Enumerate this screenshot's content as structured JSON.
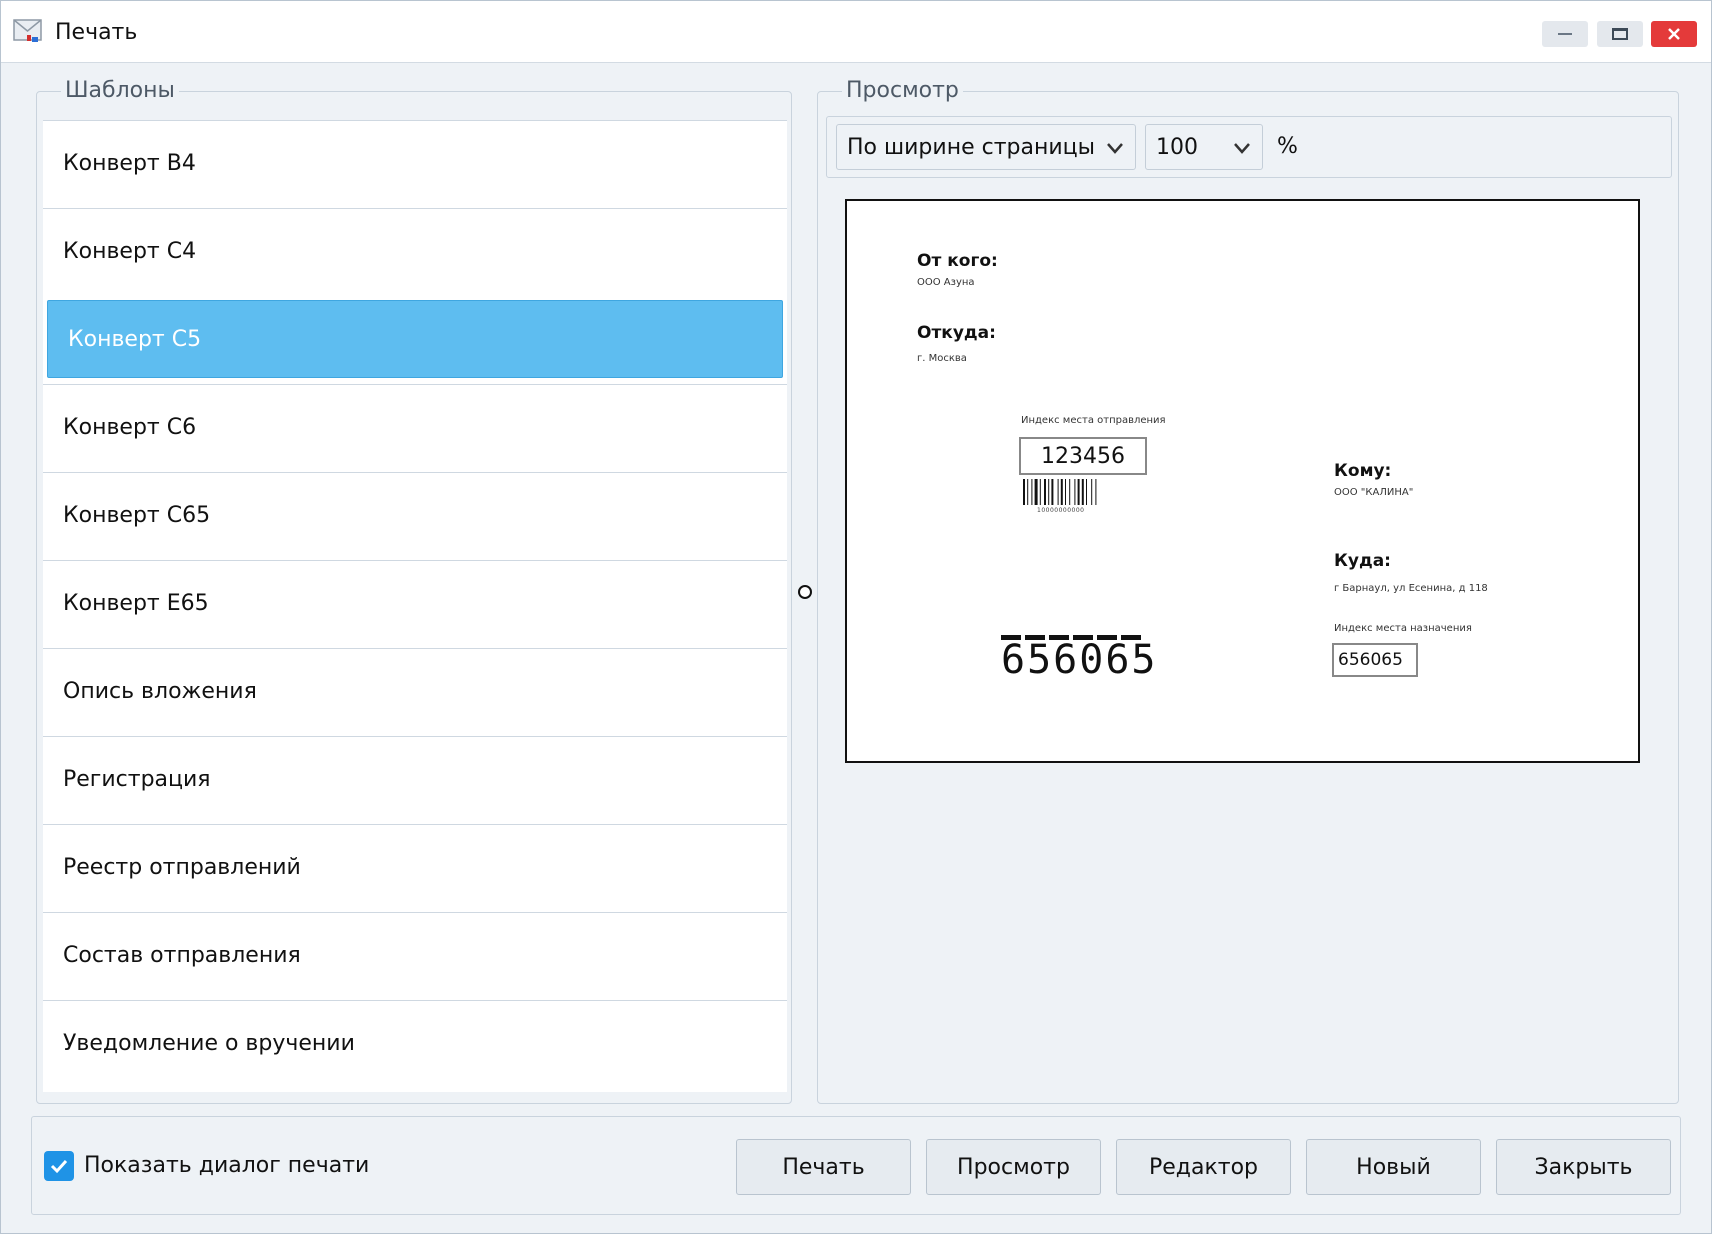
{
  "window": {
    "title": "Печать",
    "icon": "envelope-app-icon",
    "controls": [
      "minimize-icon",
      "maximize-icon",
      "close-icon"
    ],
    "close_color": "#e43a3a"
  },
  "templates": {
    "legend": "Шаблоны",
    "items": [
      {
        "label": "Конверт B4",
        "selected": false
      },
      {
        "label": "Конверт C4",
        "selected": false
      },
      {
        "label": "Конверт C5",
        "selected": true
      },
      {
        "label": "Конверт C6",
        "selected": false
      },
      {
        "label": "Конверт C65",
        "selected": false
      },
      {
        "label": "Конверт E65",
        "selected": false
      },
      {
        "label": "Опись вложения",
        "selected": false
      },
      {
        "label": "Регистрация",
        "selected": false
      },
      {
        "label": "Реестр отправлений",
        "selected": false
      },
      {
        "label": "Состав отправления",
        "selected": false
      },
      {
        "label": "Уведомление о вручении",
        "selected": false
      }
    ],
    "selected_color": "#5ebdf0"
  },
  "preview": {
    "legend": "Просмотр",
    "fit_mode": "По ширине страницы",
    "zoom": "100",
    "zoom_unit": "%",
    "envelope": {
      "from_label": "От кого:",
      "from_value": "ООО Азуна",
      "from_where_label": "Откуда:",
      "from_where_value": "г. Москва",
      "sender_index_label": "Индекс места отправления",
      "sender_index": "123456",
      "barcode_number": "10000000000",
      "to_label": "Кому:",
      "to_value": "ООО \"КАЛИНА\"",
      "to_where_label": "Куда:",
      "to_where_value": "г Барнаул, ул Есенина, д 118",
      "dest_index_label": "Индекс места назначения",
      "dest_index": "656065",
      "postcode_digits": "656065"
    }
  },
  "bottom": {
    "show_dialog_label": "Показать диалог печати",
    "show_dialog_checked": true,
    "checkbox_color": "#1f93e6",
    "buttons": {
      "print": "Печать",
      "preview": "Просмотр",
      "editor": "Редактор",
      "new": "Новый",
      "close": "Закрыть"
    }
  }
}
